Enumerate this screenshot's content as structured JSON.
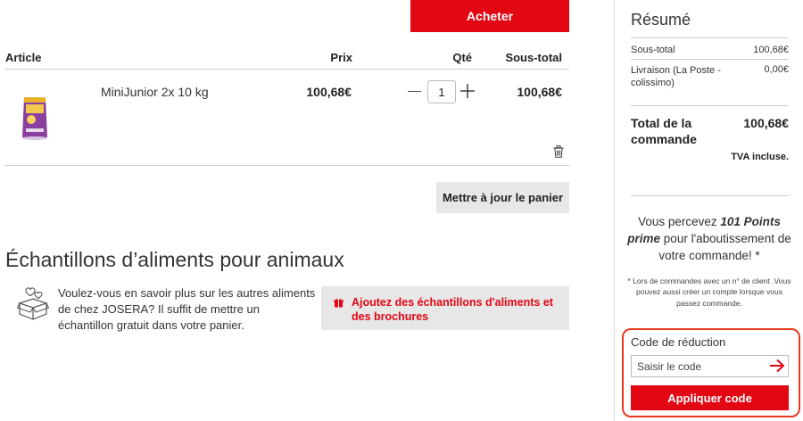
{
  "cart": {
    "buy_label": "Acheter",
    "headers": {
      "article": "Article",
      "price": "Prix",
      "qty": "Qté",
      "subtotal": "Sous-total"
    },
    "items": [
      {
        "name": "MiniJunior 2x 10 kg",
        "price": "100,68€",
        "qty": "1",
        "subtotal": "100,68€"
      }
    ],
    "update_label": "Mettre à jour le panier"
  },
  "samples": {
    "title": "Échantillons d’aliments pour animaux",
    "text": "Voulez-vous en savoir plus sur les autres aliments de chez JOSERA? Il suffit de mettre un échantillon gratuit dans votre panier.",
    "button_label": "Ajoutez des échantillons d'aliments et des brochures"
  },
  "summary": {
    "title": "Résumé",
    "subtotal_label": "Sous-total",
    "subtotal_value": "100,68€",
    "shipping_label": "Livraison (La Poste - colissimo)",
    "shipping_value": "0,00€",
    "total_label": "Total de la commande",
    "total_value": "100,68€",
    "tax_note": "TVA incluse.",
    "points": {
      "before": "Vous percevez ",
      "bold": "101 Points prime",
      "after": " pour l'aboutissement de votre commande! *"
    },
    "points_note": "* Lors de commandes avec un n° de client .Vous pouvez aussi créer un compte lorsque vous passez commande."
  },
  "promo": {
    "label": "Code de réduction",
    "placeholder": "Saisir le code",
    "apply_label": "Appliquer code"
  },
  "colors": {
    "brand_red": "#e30613",
    "highlight": "#e83a1e",
    "button_grey": "#e7e7e7"
  }
}
